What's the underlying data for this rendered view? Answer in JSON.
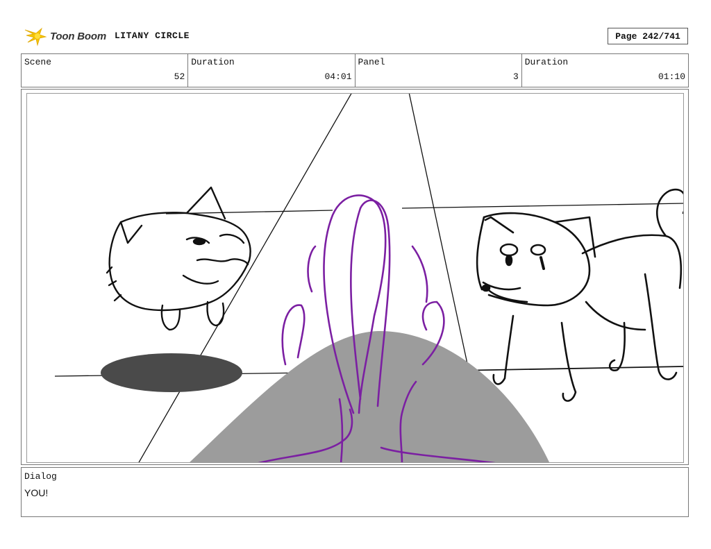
{
  "header": {
    "logo_text": "Toon Boom",
    "project_title": "LITANY CIRCLE",
    "page_label": "Page 242/741"
  },
  "info": {
    "scene_label": "Scene",
    "scene_value": "52",
    "duration_label": "Duration",
    "duration_value": "04:01",
    "panel_label": "Panel",
    "panel_value": "3",
    "panel_duration_label": "Duration",
    "panel_duration_value": "01:10"
  },
  "dialog": {
    "label": "Dialog",
    "text": "YOU!"
  },
  "colors": {
    "shadow_dark": "#4a4a4a",
    "mound_gray": "#9c9c9c",
    "plume_purple": "#7b1fa2",
    "logo_yellow": "#f5c400"
  },
  "icons": {
    "logo": "toon-boom-star-icon"
  }
}
